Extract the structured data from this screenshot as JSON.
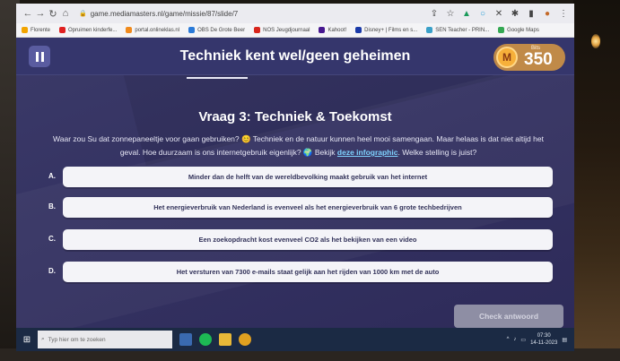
{
  "browser": {
    "url": "game.mediamasters.nl/game/missie/87/slide/7",
    "bookmarks": [
      {
        "label": "Florente",
        "color": "#f2a400"
      },
      {
        "label": "Opruimen kinderfe...",
        "color": "#e02020"
      },
      {
        "label": "portal.onlineklas.nl",
        "color": "#f08a1c"
      },
      {
        "label": "OBS De Grote Beer",
        "color": "#2a7ad8"
      },
      {
        "label": "NOS Jeugdjournaal",
        "color": "#d8261c"
      },
      {
        "label": "Kahoot!",
        "color": "#46178f"
      },
      {
        "label": "Disney+ | Films en s...",
        "color": "#1a3aa8"
      },
      {
        "label": "SEN Teacher - PRIN...",
        "color": "#3aa0c8"
      },
      {
        "label": "Google Maps",
        "color": "#34a853"
      }
    ]
  },
  "game": {
    "title": "Techniek kent wel/geen geheimen",
    "bits_label": "Bits",
    "bits_value": "350",
    "coin_letter": "M"
  },
  "question": {
    "title": "Vraag 3: Techniek & Toekomst",
    "body_part1": "Waar zou Su dat zonnepaneeltje voor gaan gebruiken? 😊 Techniek en de natuur kunnen heel mooi samengaan. Maar helaas is dat niet altijd het geval. Hoe duurzaam is ons internetgebruik eigenlijk? 🌍 Bekijk ",
    "link": "deze infographic",
    "body_part2": ". Welke stelling is juist?"
  },
  "answers": [
    {
      "letter": "A.",
      "text": "Minder dan de helft van de wereldbevolking maakt gebruik van het internet"
    },
    {
      "letter": "B.",
      "text": "Het energieverbruik van Nederland is evenveel als het energieverbruik van 6 grote techbedrijven"
    },
    {
      "letter": "C.",
      "text": "Een zoekopdracht kost evenveel CO2 als het bekijken van een video"
    },
    {
      "letter": "D.",
      "text": "Het versturen van 7300 e-mails staat gelijk aan het rijden van 1000 km met de auto"
    }
  ],
  "check_button": "Check antwoord",
  "taskbar": {
    "search_placeholder": "Typ hier om te zoeken",
    "time": "07:30",
    "date": "14-11-2023"
  }
}
